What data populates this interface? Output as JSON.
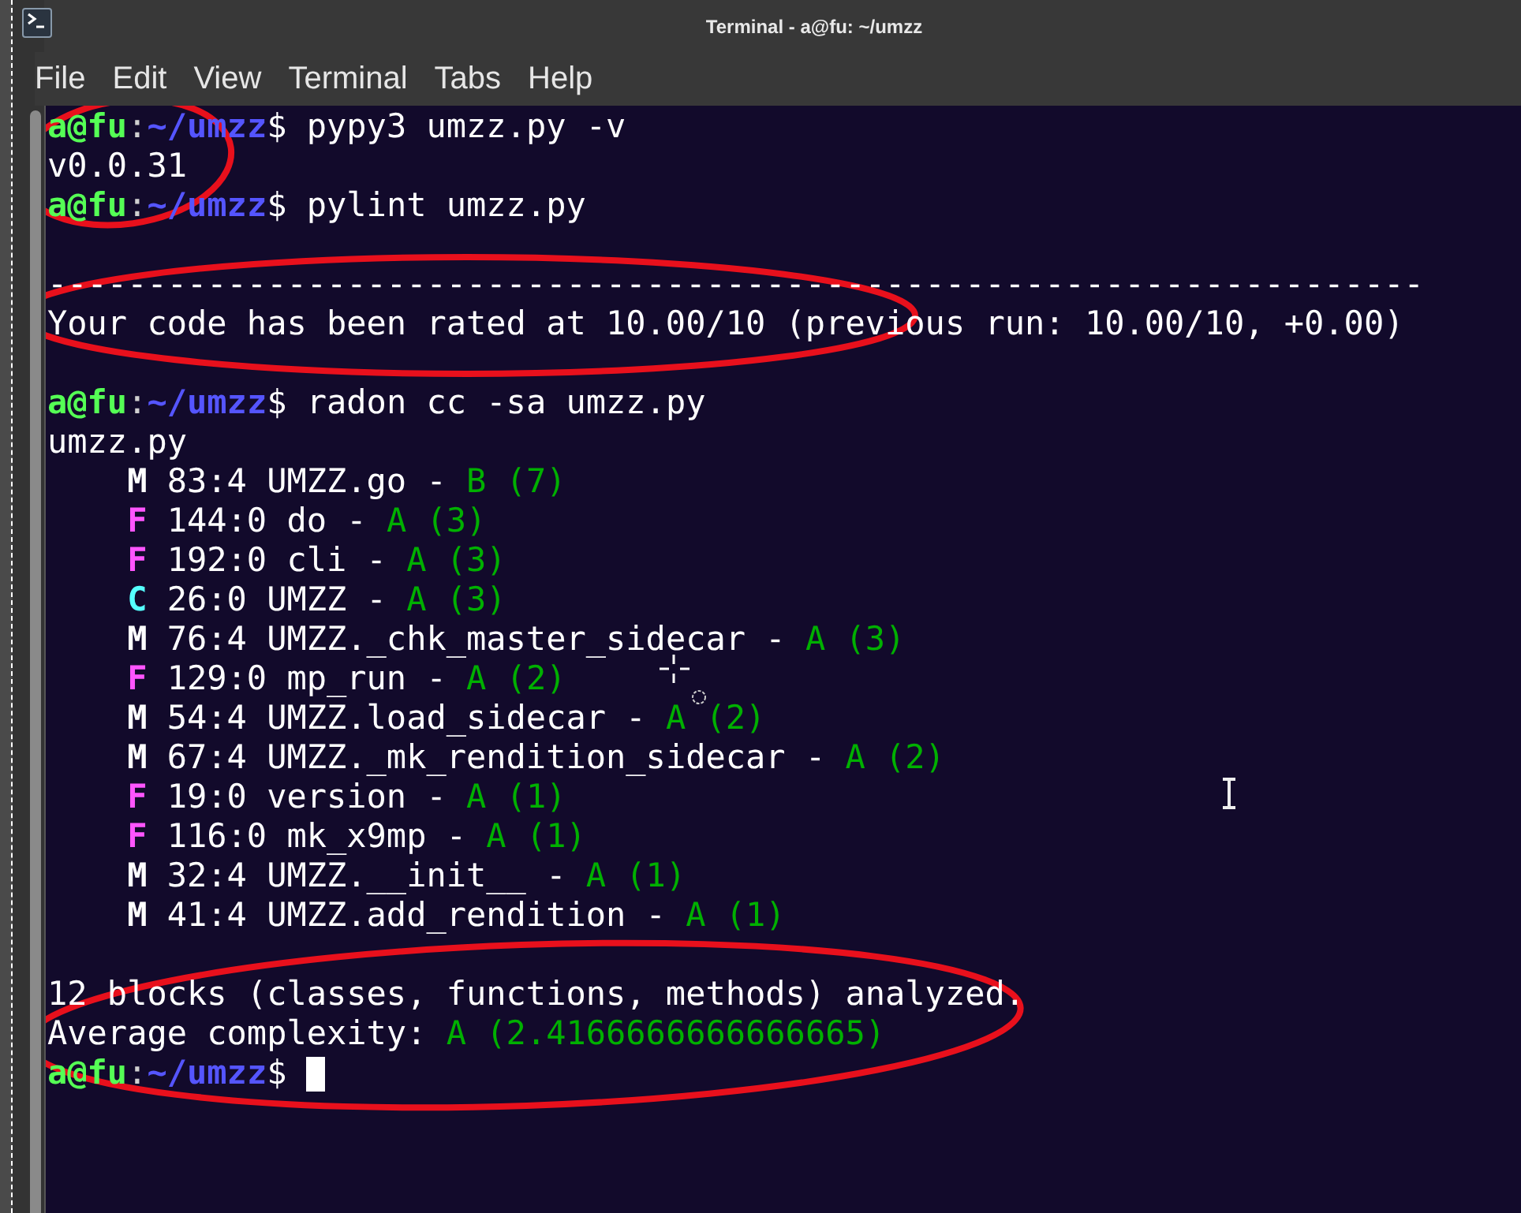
{
  "window": {
    "title": "Terminal - a@fu: ~/umzz"
  },
  "menu": [
    "File",
    "Edit",
    "View",
    "Terminal",
    "Tabs",
    "Help"
  ],
  "terminal_lines": [
    {
      "segments": [
        {
          "text": "a@fu",
          "color": "#55ff55",
          "bold": true
        },
        {
          "text": ":",
          "color": "#d0d0d0",
          "bold": false
        },
        {
          "text": "~/umzz",
          "color": "#5555ff",
          "bold": true
        },
        {
          "text": "$ pypy3 umzz.py -v",
          "color": "#ffffff",
          "bold": false
        }
      ]
    },
    {
      "segments": [
        {
          "text": "v0.0.31",
          "color": "#ffffff",
          "bold": false
        }
      ]
    },
    {
      "segments": [
        {
          "text": "a@fu",
          "color": "#55ff55",
          "bold": true
        },
        {
          "text": ":",
          "color": "#d0d0d0",
          "bold": false
        },
        {
          "text": "~/umzz",
          "color": "#5555ff",
          "bold": true
        },
        {
          "text": "$ pylint umzz.py",
          "color": "#ffffff",
          "bold": false
        }
      ]
    },
    {
      "kind": "blank"
    },
    {
      "segments": [
        {
          "text": "---------------------------------------------------------------------",
          "color": "#ffffff",
          "bold": false
        }
      ]
    },
    {
      "segments": [
        {
          "text": "Your code has been rated at 10.00/10 (previous run: 10.00/10, +0.00)",
          "color": "#ffffff",
          "bold": false
        }
      ]
    },
    {
      "kind": "blank"
    },
    {
      "segments": [
        {
          "text": "a@fu",
          "color": "#55ff55",
          "bold": true
        },
        {
          "text": ":",
          "color": "#d0d0d0",
          "bold": false
        },
        {
          "text": "~/umzz",
          "color": "#5555ff",
          "bold": true
        },
        {
          "text": "$ radon cc -sa umzz.py",
          "color": "#ffffff",
          "bold": false
        }
      ]
    },
    {
      "segments": [
        {
          "text": "umzz.py",
          "color": "#ffffff",
          "bold": false
        }
      ]
    },
    {
      "segments": [
        {
          "text": "    M",
          "color": "#ffffff",
          "bold": true
        },
        {
          "text": " 83:4 UMZZ.go - ",
          "color": "#ffffff",
          "bold": false
        },
        {
          "text": "B (7)",
          "color": "#00b000",
          "bold": false
        }
      ]
    },
    {
      "segments": [
        {
          "text": "    F",
          "color": "#ff55ff",
          "bold": true
        },
        {
          "text": " 144:0 do - ",
          "color": "#ffffff",
          "bold": false
        },
        {
          "text": "A (3)",
          "color": "#00b000",
          "bold": false
        }
      ]
    },
    {
      "segments": [
        {
          "text": "    F",
          "color": "#ff55ff",
          "bold": true
        },
        {
          "text": " 192:0 cli - ",
          "color": "#ffffff",
          "bold": false
        },
        {
          "text": "A (3)",
          "color": "#00b000",
          "bold": false
        }
      ]
    },
    {
      "segments": [
        {
          "text": "    C",
          "color": "#55ffff",
          "bold": true
        },
        {
          "text": " 26:0 UMZZ - ",
          "color": "#ffffff",
          "bold": false
        },
        {
          "text": "A (3)",
          "color": "#00b000",
          "bold": false
        }
      ]
    },
    {
      "segments": [
        {
          "text": "    M",
          "color": "#ffffff",
          "bold": true
        },
        {
          "text": " 76:4 UMZZ._chk_master_sidecar - ",
          "color": "#ffffff",
          "bold": false
        },
        {
          "text": "A (3)",
          "color": "#00b000",
          "bold": false
        }
      ]
    },
    {
      "segments": [
        {
          "text": "    F",
          "color": "#ff55ff",
          "bold": true
        },
        {
          "text": " 129:0 mp_run - ",
          "color": "#ffffff",
          "bold": false
        },
        {
          "text": "A (2)",
          "color": "#00b000",
          "bold": false
        }
      ]
    },
    {
      "segments": [
        {
          "text": "    M",
          "color": "#ffffff",
          "bold": true
        },
        {
          "text": " 54:4 UMZZ.load_sidecar - ",
          "color": "#ffffff",
          "bold": false
        },
        {
          "text": "A (2)",
          "color": "#00b000",
          "bold": false
        }
      ]
    },
    {
      "segments": [
        {
          "text": "    M",
          "color": "#ffffff",
          "bold": true
        },
        {
          "text": " 67:4 UMZZ._mk_rendition_sidecar - ",
          "color": "#ffffff",
          "bold": false
        },
        {
          "text": "A (2)",
          "color": "#00b000",
          "bold": false
        }
      ]
    },
    {
      "segments": [
        {
          "text": "    F",
          "color": "#ff55ff",
          "bold": true
        },
        {
          "text": " 19:0 version - ",
          "color": "#ffffff",
          "bold": false
        },
        {
          "text": "A (1)",
          "color": "#00b000",
          "bold": false
        }
      ]
    },
    {
      "segments": [
        {
          "text": "    F",
          "color": "#ff55ff",
          "bold": true
        },
        {
          "text": " 116:0 mk_x9mp - ",
          "color": "#ffffff",
          "bold": false
        },
        {
          "text": "A (1)",
          "color": "#00b000",
          "bold": false
        }
      ]
    },
    {
      "segments": [
        {
          "text": "    M",
          "color": "#ffffff",
          "bold": true
        },
        {
          "text": " 32:4 UMZZ.__init__ - ",
          "color": "#ffffff",
          "bold": false
        },
        {
          "text": "A (1)",
          "color": "#00b000",
          "bold": false
        }
      ]
    },
    {
      "segments": [
        {
          "text": "    M",
          "color": "#ffffff",
          "bold": true
        },
        {
          "text": " 41:4 UMZZ.add_rendition - ",
          "color": "#ffffff",
          "bold": false
        },
        {
          "text": "A (1)",
          "color": "#00b000",
          "bold": false
        }
      ]
    },
    {
      "kind": "blank"
    },
    {
      "segments": [
        {
          "text": "12 blocks (classes, functions, methods) analyzed.",
          "color": "#ffffff",
          "bold": false
        }
      ]
    },
    {
      "segments": [
        {
          "text": "Average complexity: ",
          "color": "#ffffff",
          "bold": false
        },
        {
          "text": "A (2.4166666666666665)",
          "color": "#00b000",
          "bold": false
        }
      ]
    },
    {
      "segments": [
        {
          "text": "a@fu",
          "color": "#55ff55",
          "bold": true
        },
        {
          "text": ":",
          "color": "#d0d0d0",
          "bold": false
        },
        {
          "text": "~/umzz",
          "color": "#5555ff",
          "bold": true
        },
        {
          "text": "$ ",
          "color": "#ffffff",
          "bold": false
        }
      ],
      "cursor": true
    }
  ]
}
